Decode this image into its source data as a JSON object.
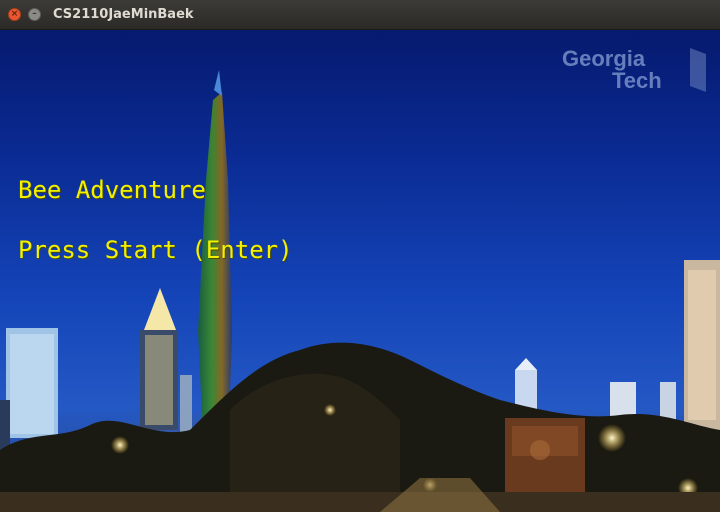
{
  "window": {
    "title": "CS2110JaeMinBaek",
    "close_glyph": "×",
    "minimize_glyph": "–"
  },
  "game": {
    "title": "Bee Adventure",
    "prompt": "Press Start (Enter)",
    "text_color": "#f2f200"
  },
  "logo": {
    "line1": "Georgia",
    "line2": "Tech"
  },
  "icons": [
    "close-icon",
    "minimize-icon"
  ]
}
